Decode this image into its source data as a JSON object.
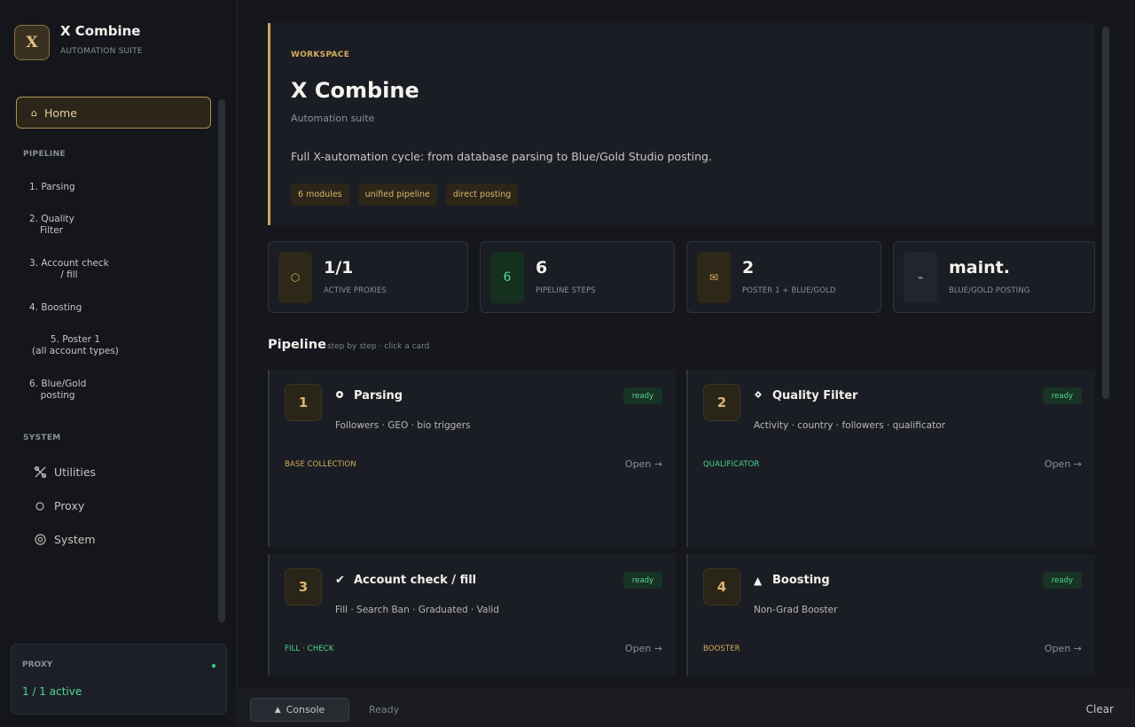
{
  "brand": {
    "logo_letter": "X",
    "title": "X Combine",
    "subtitle": "AUTOMATION SUITE"
  },
  "sidebar": {
    "home_label": "Home",
    "pipeline_section": "PIPELINE",
    "steps": [
      {
        "line1": "1. Parsing",
        "line2": ""
      },
      {
        "line1": "2. Quality",
        "line2": "Filter"
      },
      {
        "line1": "3. Account check",
        "line2": "/ fill"
      },
      {
        "line1": "4. Boosting",
        "line2": ""
      },
      {
        "line1": "5. Poster 1",
        "line2": "(all account types)"
      },
      {
        "line1": "6. Blue/Gold",
        "line2": "posting"
      }
    ],
    "system_section": "SYSTEM",
    "system_items": [
      {
        "label": "Utilities",
        "icon": "tools-icon"
      },
      {
        "label": "Proxy",
        "icon": "circle-icon"
      },
      {
        "label": "System",
        "icon": "gear-icon"
      }
    ],
    "proxy_card": {
      "label": "PROXY",
      "value": "1 / 1 active",
      "status_color": "#3fcf83"
    }
  },
  "hero": {
    "eyebrow": "WORKSPACE",
    "title": "X Combine",
    "subtitle": "Automation suite",
    "description": "Full X-automation cycle: from database parsing to Blue/Gold Studio posting.",
    "tags": [
      "6 modules",
      "unified pipeline",
      "direct posting"
    ],
    "accent_color": "#c9a35c"
  },
  "stats": [
    {
      "value": "1/1",
      "label": "ACTIVE PROXIES",
      "icon": "hexagon-icon"
    },
    {
      "value": "6",
      "label": "PIPELINE STEPS",
      "icon_text": "6"
    },
    {
      "value": "2",
      "label": "POSTER 1 + BLUE/GOLD",
      "icon": "mail-icon"
    },
    {
      "value": "maint.",
      "label": "BLUE/GOLD POSTING",
      "icon": "wave-icon"
    }
  ],
  "pipeline": {
    "title": "Pipeline",
    "hint": "step by step · click a card",
    "cards": [
      {
        "num": "1",
        "title": "Parsing",
        "icon": "eye-icon",
        "desc": "Followers · GEO · bio triggers",
        "badge": "ready",
        "category": "BASE COLLECTION",
        "category_color": "#d6ac5d",
        "open": "Open →"
      },
      {
        "num": "2",
        "title": "Quality Filter",
        "icon": "diamond-icon",
        "desc": "Activity · country · followers · qualificator",
        "badge": "ready",
        "category": "QUALIFICATOR",
        "category_color": "#4fd890",
        "open": "Open →"
      },
      {
        "num": "3",
        "title": "Account check / fill",
        "icon": "check-icon",
        "desc": "Fill · Search Ban · Graduated · Valid",
        "badge": "ready",
        "category": "FILL · CHECK",
        "category_color": "#4fd890",
        "open": "Open →"
      },
      {
        "num": "4",
        "title": "Boosting",
        "icon": "triangle-icon",
        "desc": "Non-Grad Booster",
        "badge": "ready",
        "category": "BOOSTER",
        "category_color": "#d6ac5d",
        "open": "Open →"
      }
    ]
  },
  "console": {
    "button_label": "Console",
    "status": "Ready",
    "clear_label": "Clear"
  }
}
